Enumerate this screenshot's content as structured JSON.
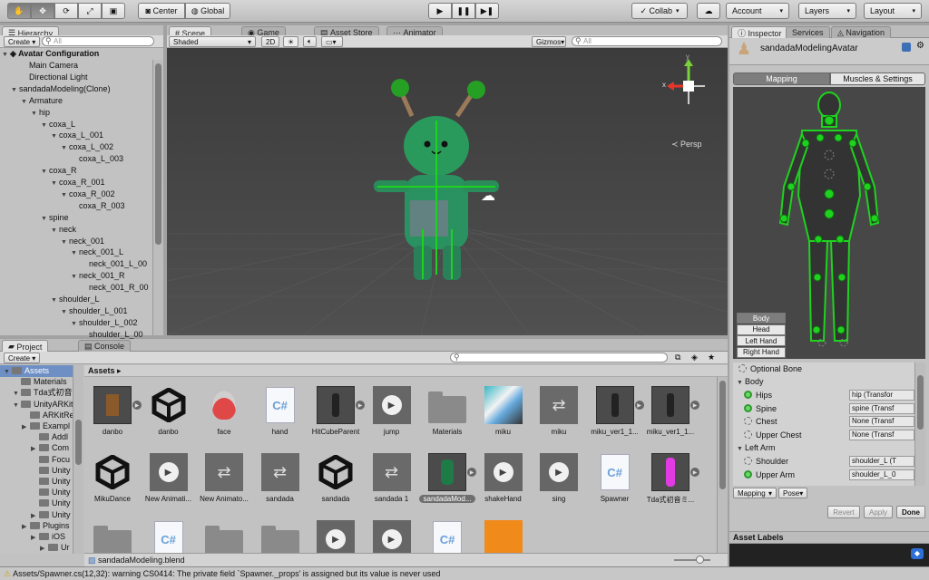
{
  "toolbar": {
    "center": "Center",
    "global": "Global",
    "collab": "Collab",
    "account": "Account",
    "layers": "Layers",
    "layout": "Layout"
  },
  "hierarchy": {
    "tab": "Hierarchy",
    "create": "Create",
    "search_placeholder": "All",
    "scene": "Avatar Configuration",
    "rows": [
      {
        "label": "Main Camera",
        "depth": 1,
        "arrow": false
      },
      {
        "label": "Directional Light",
        "depth": 1,
        "arrow": false
      },
      {
        "label": "sandadaModeling(Clone)",
        "depth": 0,
        "arrow": true
      },
      {
        "label": "Armature",
        "depth": 1,
        "arrow": true
      },
      {
        "label": "hip",
        "depth": 2,
        "arrow": true
      },
      {
        "label": "coxa_L",
        "depth": 3,
        "arrow": true
      },
      {
        "label": "coxa_L_001",
        "depth": 4,
        "arrow": true
      },
      {
        "label": "coxa_L_002",
        "depth": 5,
        "arrow": true
      },
      {
        "label": "coxa_L_003",
        "depth": 6,
        "arrow": false
      },
      {
        "label": "coxa_R",
        "depth": 3,
        "arrow": true
      },
      {
        "label": "coxa_R_001",
        "depth": 4,
        "arrow": true
      },
      {
        "label": "coxa_R_002",
        "depth": 5,
        "arrow": true
      },
      {
        "label": "coxa_R_003",
        "depth": 6,
        "arrow": false
      },
      {
        "label": "spine",
        "depth": 3,
        "arrow": true
      },
      {
        "label": "neck",
        "depth": 4,
        "arrow": true
      },
      {
        "label": "neck_001",
        "depth": 5,
        "arrow": true
      },
      {
        "label": "neck_001_L",
        "depth": 6,
        "arrow": true
      },
      {
        "label": "neck_001_L_00",
        "depth": 7,
        "arrow": false
      },
      {
        "label": "neck_001_R",
        "depth": 6,
        "arrow": true
      },
      {
        "label": "neck_001_R_00",
        "depth": 7,
        "arrow": false
      },
      {
        "label": "shoulder_L",
        "depth": 4,
        "arrow": true
      },
      {
        "label": "shoulder_L_001",
        "depth": 5,
        "arrow": true
      },
      {
        "label": "shoulder_L_002",
        "depth": 6,
        "arrow": true
      },
      {
        "label": "shoulder_L_00",
        "depth": 7,
        "arrow": false
      }
    ]
  },
  "scene": {
    "tabs": [
      "Scene",
      "Game",
      "Asset Store",
      "Animator"
    ],
    "shading": "Shaded",
    "mode2d": "2D",
    "gizmos": "Gizmos",
    "search_placeholder": "All",
    "persp": "Persp",
    "axis_x": "x",
    "axis_y": "y"
  },
  "project": {
    "tabs": [
      "Project",
      "Console"
    ],
    "create": "Create",
    "breadcrumb": "Assets",
    "tree": [
      {
        "label": "Assets",
        "depth": 0,
        "arrow": true,
        "selected": true
      },
      {
        "label": "Materials",
        "depth": 1,
        "arrow": false
      },
      {
        "label": "Tda式初音",
        "depth": 1,
        "arrow": true
      },
      {
        "label": "UnityARKit",
        "depth": 1,
        "arrow": true
      },
      {
        "label": "ARKitRe",
        "depth": 2,
        "arrow": false
      },
      {
        "label": "Exampl",
        "depth": 2,
        "arrow": true
      },
      {
        "label": "Addl",
        "depth": 3,
        "arrow": false
      },
      {
        "label": "Com",
        "depth": 3,
        "arrow": true
      },
      {
        "label": "Focu",
        "depth": 3,
        "arrow": false
      },
      {
        "label": "Unity",
        "depth": 3,
        "arrow": false
      },
      {
        "label": "Unity",
        "depth": 3,
        "arrow": false
      },
      {
        "label": "Unity",
        "depth": 3,
        "arrow": false
      },
      {
        "label": "Unity",
        "depth": 3,
        "arrow": false
      },
      {
        "label": "Unity",
        "depth": 3,
        "arrow": true
      },
      {
        "label": "Plugins",
        "depth": 2,
        "arrow": true
      },
      {
        "label": "iOS",
        "depth": 3,
        "arrow": true
      },
      {
        "label": "Ur",
        "depth": 4,
        "arrow": true
      }
    ],
    "assets": [
      {
        "label": "danbo",
        "kind": "prefab-danbo"
      },
      {
        "label": "danbo",
        "kind": "unity"
      },
      {
        "label": "face",
        "kind": "face"
      },
      {
        "label": "hand",
        "kind": "cs"
      },
      {
        "label": "HitCubeParent",
        "kind": "prefab-char"
      },
      {
        "label": "jump",
        "kind": "anim"
      },
      {
        "label": "Materials",
        "kind": "folder"
      },
      {
        "label": "miku",
        "kind": "texture"
      },
      {
        "label": "miku",
        "kind": "controller"
      },
      {
        "label": "miku_ver1_1...",
        "kind": "prefab-char"
      },
      {
        "label": "miku_ver1_1...",
        "kind": "prefab-char"
      },
      {
        "label": "MikuDance",
        "kind": "unity"
      },
      {
        "label": "New Animati...",
        "kind": "anim"
      },
      {
        "label": "New Animato...",
        "kind": "controller"
      },
      {
        "label": "sandada",
        "kind": "controller"
      },
      {
        "label": "sandada",
        "kind": "unity"
      },
      {
        "label": "sandada 1",
        "kind": "controller"
      },
      {
        "label": "sandadaMod...",
        "kind": "prefab-green",
        "selected": true
      },
      {
        "label": "shakeHand",
        "kind": "anim"
      },
      {
        "label": "sing",
        "kind": "anim"
      },
      {
        "label": "Spawner",
        "kind": "cs"
      },
      {
        "label": "Tda式初音ミ...",
        "kind": "prefab-pink"
      },
      {
        "label": "",
        "kind": "folder"
      },
      {
        "label": "",
        "kind": "cs"
      },
      {
        "label": "",
        "kind": "folder"
      },
      {
        "label": "",
        "kind": "folder"
      },
      {
        "label": "",
        "kind": "anim"
      },
      {
        "label": "",
        "kind": "anim"
      },
      {
        "label": "",
        "kind": "cs"
      },
      {
        "label": "",
        "kind": "orange"
      }
    ],
    "selected_path": "sandadaModeling.blend"
  },
  "inspector": {
    "tabs": [
      "Inspector",
      "Services",
      "Navigation"
    ],
    "object_name": "sandadaModelingAvatar",
    "mode_tabs": [
      "Mapping",
      "Muscles & Settings"
    ],
    "part_buttons": [
      "Body",
      "Head",
      "Left Hand",
      "Right Hand"
    ],
    "optional_bone": "Optional Bone",
    "sections": [
      {
        "title": "Body",
        "bones": [
          {
            "name": "Hips",
            "value": "hip (Transfor",
            "required": true
          },
          {
            "name": "Spine",
            "value": "spine (Transf",
            "required": true
          },
          {
            "name": "Chest",
            "value": "None (Transf",
            "required": false
          },
          {
            "name": "Upper Chest",
            "value": "None (Transf",
            "required": false
          }
        ]
      },
      {
        "title": "Left Arm",
        "bones": [
          {
            "name": "Shoulder",
            "value": "shoulder_L (T",
            "required": false
          },
          {
            "name": "Upper Arm",
            "value": "shoulder_L_0",
            "required": true
          }
        ]
      }
    ],
    "bottom_tabs": [
      "Mapping",
      "Pose"
    ],
    "revert": "Revert",
    "apply": "Apply",
    "done": "Done",
    "asset_labels": "Asset Labels"
  },
  "console": {
    "message": "Assets/Spawner.cs(12,32): warning CS0414: The private field `Spawner._props' is assigned but its value is never used"
  },
  "colors": {
    "avatar_green": "#1fd21f",
    "selection": "#3d6fb5"
  }
}
